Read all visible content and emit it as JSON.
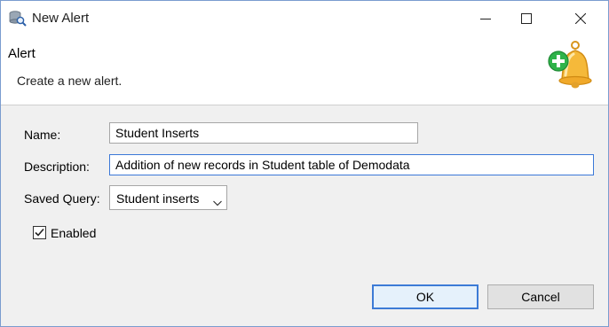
{
  "window": {
    "title": "New Alert",
    "app_icon": "database-search-icon"
  },
  "banner": {
    "title": "Alert",
    "description": "Create a new alert.",
    "icon": "bell-add-icon"
  },
  "form": {
    "name_label": "Name:",
    "name_value": "Student Inserts",
    "description_label": "Description:",
    "description_value": "Addition of new records in Student table of Demodata",
    "saved_query_label": "Saved Query:",
    "saved_query_value": "Student inserts",
    "enabled_label": "Enabled",
    "enabled_checked": true
  },
  "buttons": {
    "ok": "OK",
    "cancel": "Cancel"
  },
  "colors": {
    "focus_border": "#3b78d8",
    "bell": "#f2b233",
    "plus": "#2fb34a"
  }
}
